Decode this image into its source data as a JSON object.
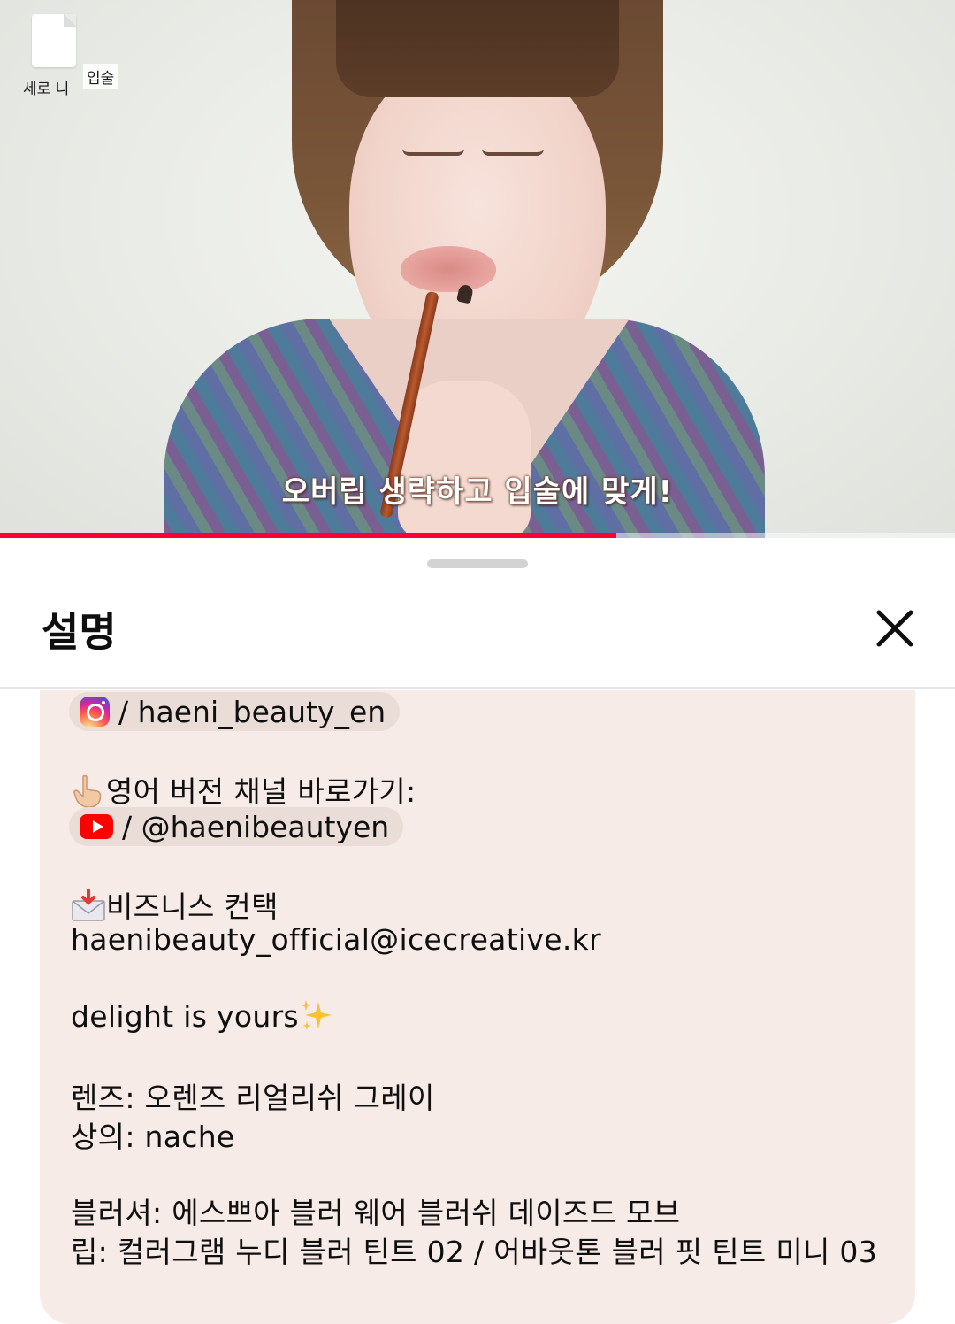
{
  "video": {
    "subtitle": "오버립 생략하고 입술에 맞게!",
    "file_label": "세로 니",
    "file_label_overlay": "입술",
    "progress_fraction": 0.645
  },
  "sheet": {
    "title": "설명",
    "close_icon": "close-icon"
  },
  "description": {
    "instagram_handle": "/ haeni_beauty_en",
    "english_channel_label": "영어 버전 채널 바로가기:",
    "youtube_handle": "/ @haenibeautyen",
    "business_label": "비즈니스 컨택",
    "business_email": "haenibeauty_official@icecreative.kr",
    "tagline": "delight is yours",
    "lens": "렌즈: 오렌즈 리얼리쉬 그레이",
    "top": "상의: nache",
    "blusher": "블러셔: 에스쁘아 블러 웨어 블러쉬 데이즈드 모브",
    "lip": "립: 컬러그램 누디 블러 틴트 02 / 어바웃톤 블러 핏 틴트 미니 03"
  },
  "icons": {
    "instagram": "instagram-icon",
    "youtube": "youtube-icon",
    "pointing": "pointing-hand-icon",
    "envelope": "envelope-icon",
    "sparkles": "sparkles-icon"
  },
  "colors": {
    "accent_red": "#ff0033",
    "desc_background": "#f6ebe7",
    "chip_background": "#eadcd7"
  }
}
